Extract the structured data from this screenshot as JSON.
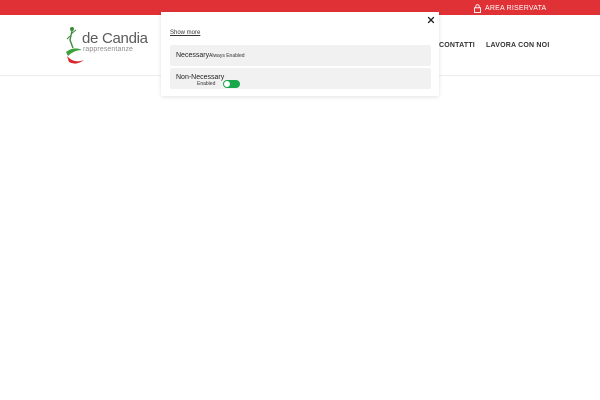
{
  "topbar": {
    "area_riservata": "AREA RISERVATA",
    "color": "#e03236",
    "icon": "lock-icon"
  },
  "header": {
    "logo": {
      "name": "de Candia",
      "sub": "rappresentanze"
    },
    "nav": [
      "CONTATTI",
      "LAVORA CON NOI"
    ]
  },
  "cookie_modal": {
    "show_more": "Show more",
    "close_icon": "close-icon",
    "categories": [
      {
        "title": "Necessary",
        "status": "Always Enabled"
      },
      {
        "title": "Non-Necessary",
        "status": "Enabled",
        "toggle_on": true,
        "toggle_color": "#1aa74b"
      }
    ]
  }
}
